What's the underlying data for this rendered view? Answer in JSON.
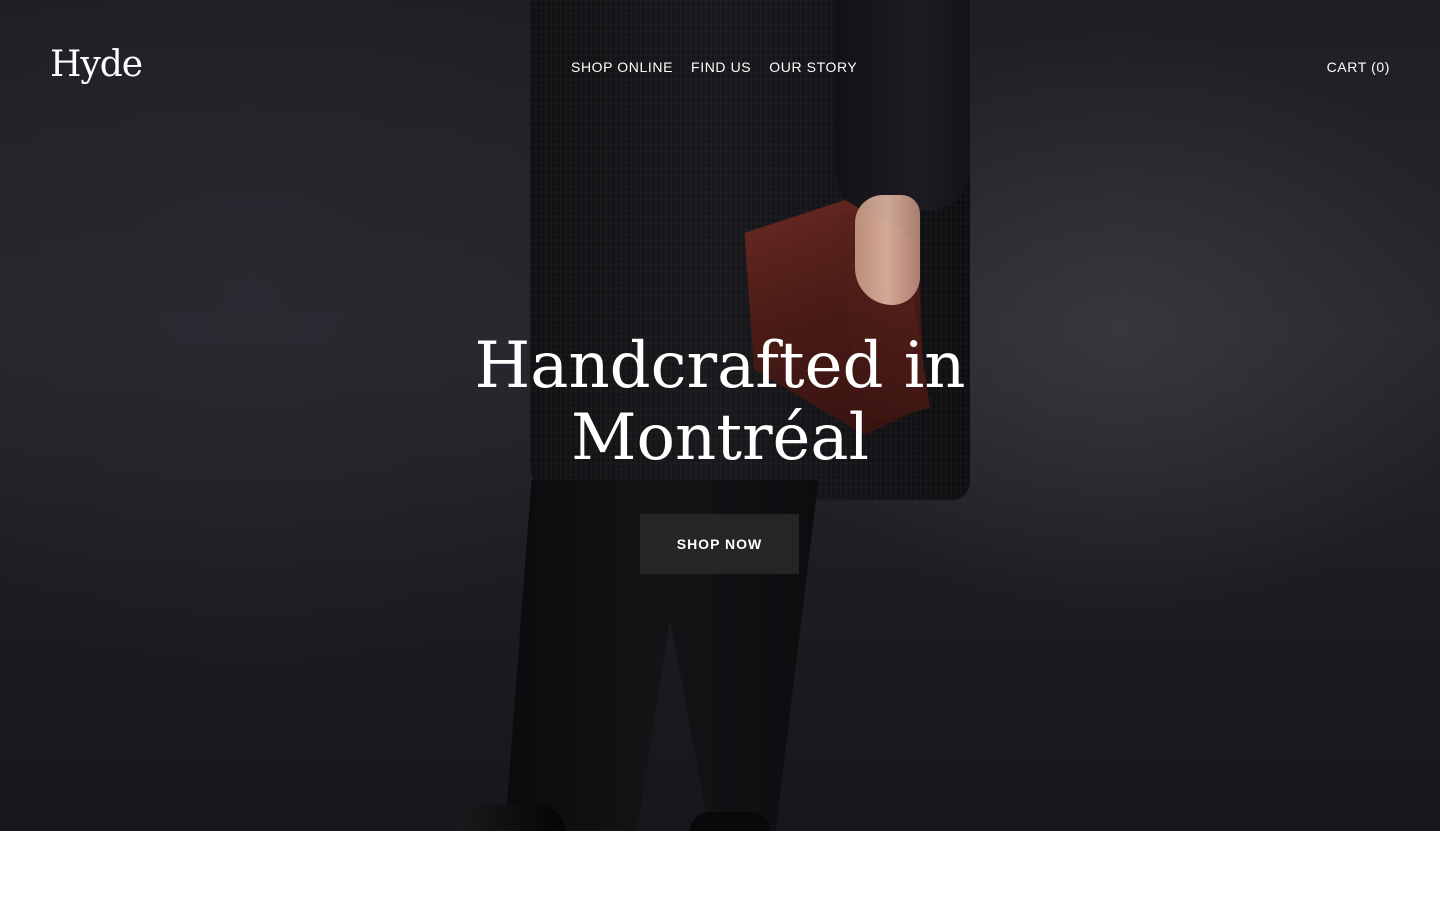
{
  "brand": {
    "logo_text": "Hyde"
  },
  "nav": {
    "items": [
      {
        "label": "SHOP ONLINE"
      },
      {
        "label": "FIND US"
      },
      {
        "label": "OUR STORY"
      }
    ],
    "cart_label": "CART (0)"
  },
  "hero": {
    "headline_line1": "Handcrafted in",
    "headline_line2": "Montréal",
    "cta_label": "SHOP NOW"
  },
  "colors": {
    "hero_bg": "#222126",
    "cta_bg": "#252527",
    "text": "#ffffff"
  }
}
